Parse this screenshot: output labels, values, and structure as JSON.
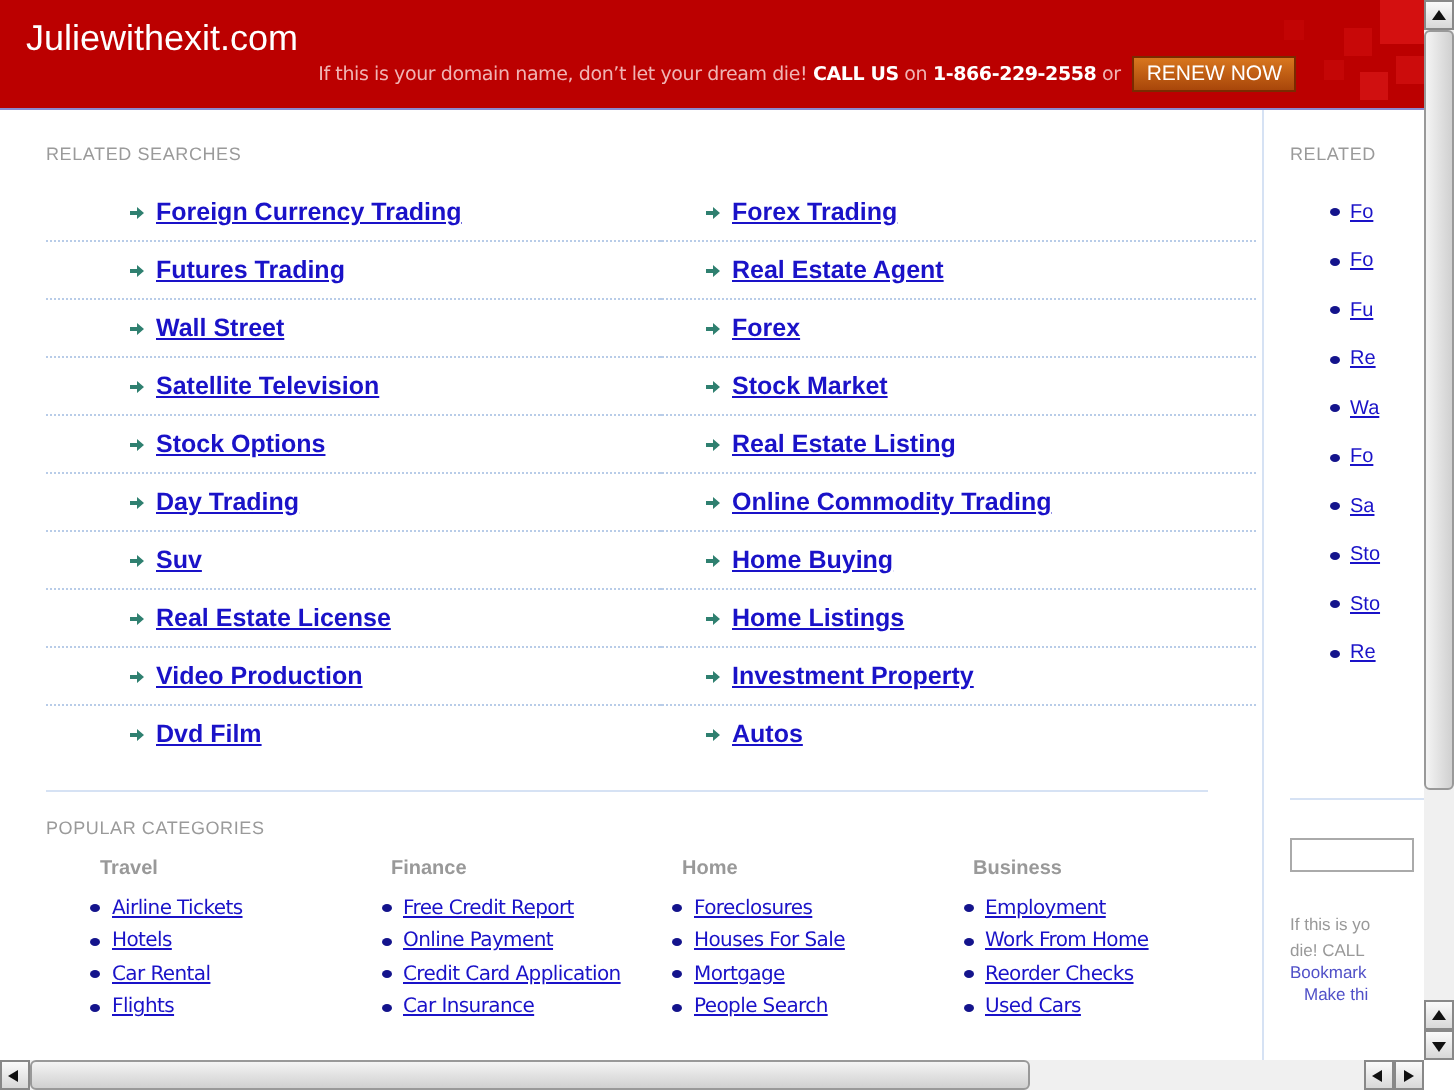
{
  "header": {
    "site_name": "Juliewithexit.com",
    "tagline": "If this is your domain name, don’t let your dream die! **CALL US** on **1-866-229-2558** or",
    "renew_button": "RENEW NOW"
  },
  "related_searches": {
    "heading": "RELATED SEARCHES",
    "links": [
      "Foreign Currency Trading",
      "Forex Trading",
      "Futures Trading",
      "Real Estate Agent",
      "Wall Street",
      "Forex",
      "Satellite Television",
      "Stock Market",
      "Stock Options",
      "Real Estate Listing",
      "Day Trading",
      "Online Commodity Trading",
      "Suv",
      "Home Buying",
      "Real Estate License",
      "Home Listings",
      "Video Production",
      "Investment Property",
      "Dvd Film",
      "Autos"
    ]
  },
  "popular_categories": {
    "heading": "POPULAR CATEGORIES",
    "columns": [
      {
        "title": "Travel",
        "links": [
          "Airline Tickets",
          "Hotels",
          "Car Rental",
          "Flights"
        ]
      },
      {
        "title": "Finance",
        "links": [
          "Free Credit Report",
          "Online Payment",
          "Credit Card Application",
          "Car Insurance"
        ]
      },
      {
        "title": "Home",
        "links": [
          "Foreclosures",
          "Houses For Sale",
          "Mortgage",
          "People Search"
        ]
      },
      {
        "title": "Business",
        "links": [
          "Employment",
          "Work From Home",
          "Reorder Checks",
          "Used Cars"
        ]
      }
    ]
  },
  "sidebar": {
    "heading": "RELATED",
    "links": [
      "Fo",
      "Fo",
      "Fu",
      "Re",
      "Wa",
      "Fo",
      "Sa",
      "Sto",
      "Sto",
      "Re"
    ],
    "notice_lines": [
      "If this is yo",
      "die! CALL"
    ],
    "bookmark_link": "Bookmark",
    "homepage_link": "Make thi"
  }
}
